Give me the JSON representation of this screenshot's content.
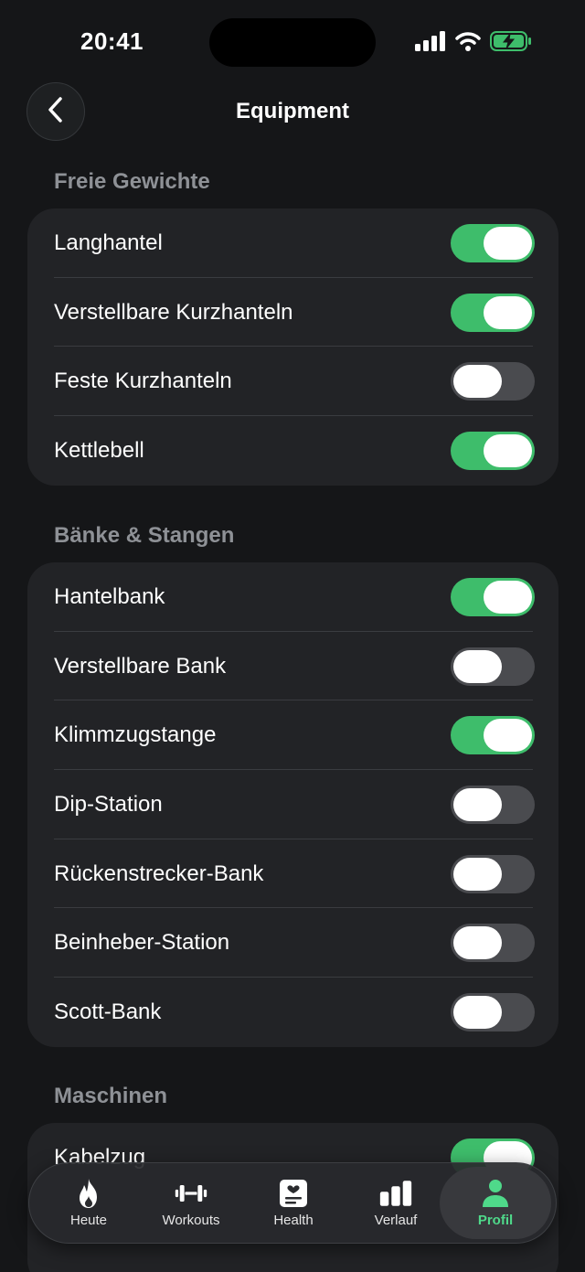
{
  "status_bar": {
    "time": "20:41",
    "icons": [
      "signal-icon",
      "wifi-icon",
      "battery-charging-icon"
    ]
  },
  "nav": {
    "title": "Equipment",
    "back_icon": "chevron-left-icon"
  },
  "colors": {
    "background": "#151618",
    "card": "#222326",
    "toggle_on": "#3ebd6b",
    "toggle_off": "#4a4b4f",
    "accent": "#4fd98a"
  },
  "sections": [
    {
      "title": "Freie Gewichte",
      "items": [
        {
          "label": "Langhantel",
          "on": true
        },
        {
          "label": "Verstellbare Kurzhanteln",
          "on": true
        },
        {
          "label": "Feste Kurzhanteln",
          "on": false
        },
        {
          "label": "Kettlebell",
          "on": true
        }
      ]
    },
    {
      "title": "Bänke & Stangen",
      "items": [
        {
          "label": "Hantelbank",
          "on": true
        },
        {
          "label": "Verstellbare Bank",
          "on": false
        },
        {
          "label": "Klimmzugstange",
          "on": true
        },
        {
          "label": "Dip-Station",
          "on": false
        },
        {
          "label": "Rückenstrecker-Bank",
          "on": false
        },
        {
          "label": "Beinheber-Station",
          "on": false
        },
        {
          "label": "Scott-Bank",
          "on": false
        }
      ]
    },
    {
      "title": "Maschinen",
      "items": [
        {
          "label": "Kabelzug",
          "on": true
        }
      ]
    }
  ],
  "tab_bar": {
    "tabs": [
      {
        "label": "Heute",
        "icon": "flame-icon",
        "active": false
      },
      {
        "label": "Workouts",
        "icon": "dumbbell-icon",
        "active": false
      },
      {
        "label": "Health",
        "icon": "health-record-icon",
        "active": false
      },
      {
        "label": "Verlauf",
        "icon": "bar-chart-icon",
        "active": false
      },
      {
        "label": "Profil",
        "icon": "person-icon",
        "active": true
      }
    ]
  }
}
